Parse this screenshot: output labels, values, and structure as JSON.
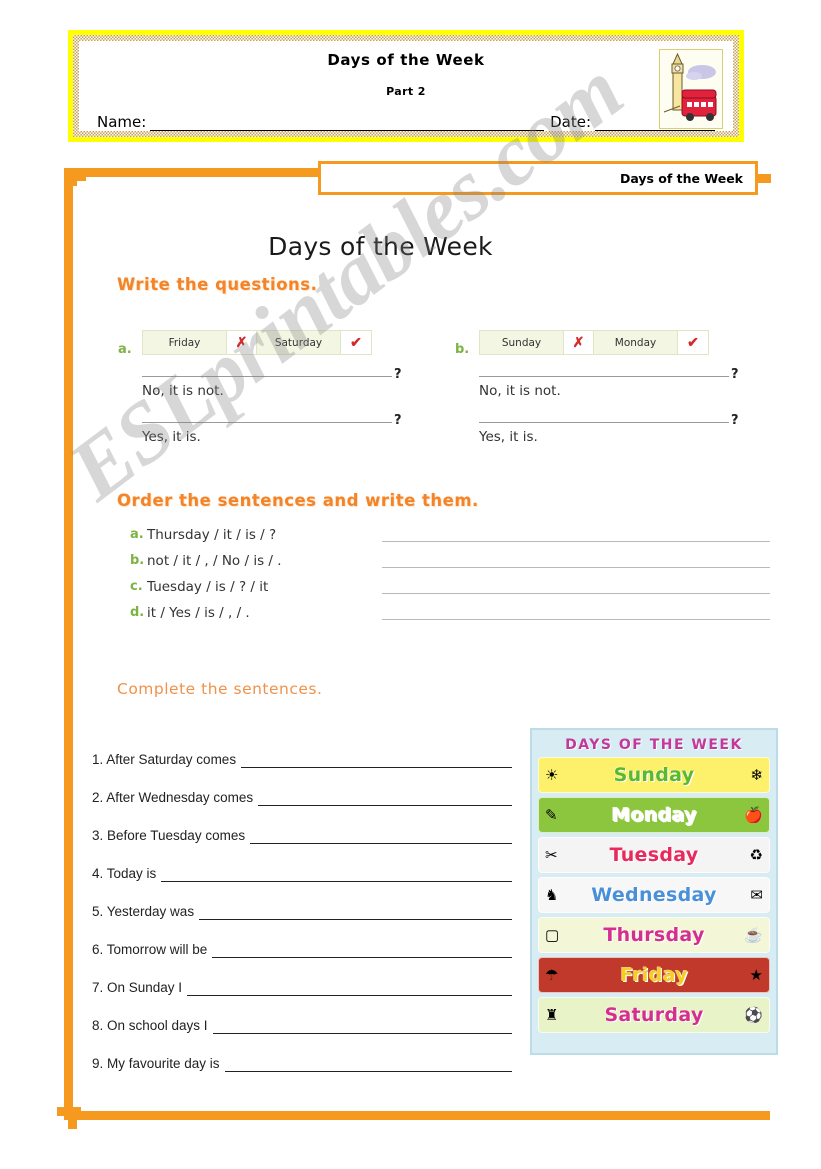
{
  "header": {
    "title": "Days of the Week",
    "part": "Part 2",
    "name_label": "Name:",
    "date_label": "Date:",
    "illustration": "big-ben-and-london-bus"
  },
  "tab": {
    "label": "Days of the Week"
  },
  "main_title": "Days of the Week",
  "watermark": "ESLprintables.com",
  "sections": {
    "write_questions": {
      "heading": "Write the questions.",
      "items": [
        {
          "label": "a.",
          "table": {
            "day1": "Friday",
            "mark1": "✗",
            "day2": "Saturday",
            "mark2": "✔"
          },
          "question_mark": "?",
          "answer1": "No, it is not.",
          "answer2": "Yes, it is."
        },
        {
          "label": "b.",
          "table": {
            "day1": "Sunday",
            "mark1": "✗",
            "day2": "Monday",
            "mark2": "✔"
          },
          "question_mark": "?",
          "answer1": "No, it is not.",
          "answer2": "Yes, it is."
        }
      ]
    },
    "order_sentences": {
      "heading": "Order the sentences and write them.",
      "items": [
        {
          "label": "a.",
          "text": "Thursday / it / is / ?"
        },
        {
          "label": "b.",
          "text": "not / it / , / No / is / ."
        },
        {
          "label": "c.",
          "text": "Tuesday / is / ? / it"
        },
        {
          "label": "d.",
          "text": "it / Yes / is / , / ."
        }
      ]
    },
    "complete_sentences": {
      "heading": "Complete the sentences.",
      "items": [
        "1. After Saturday comes",
        "2. After Wednesday comes",
        "3. Before Tuesday comes",
        "4. Today is",
        "5. Yesterday was",
        "6. Tomorrow will be",
        "7. On Sunday I",
        "8. On school days I",
        "9. My favourite day is"
      ]
    }
  },
  "poster": {
    "title": "DAYS OF THE WEEK",
    "days": [
      {
        "name": "Sunday",
        "text_color": "#5cb82e",
        "bg": "#fdf06a",
        "deco_left": "☀",
        "deco_right": "❄"
      },
      {
        "name": "Monday",
        "text_color": "#ffffff",
        "bg": "#8cc63f",
        "deco_left": "✎",
        "deco_right": "🍎"
      },
      {
        "name": "Tuesday",
        "text_color": "#e8295c",
        "bg": "#f4f4f4",
        "deco_left": "✂",
        "deco_right": "♻"
      },
      {
        "name": "Wednesday",
        "text_color": "#4a90d9",
        "bg": "#f7f7f7",
        "deco_left": "♞",
        "deco_right": "✉"
      },
      {
        "name": "Thursday",
        "text_color": "#d42f8e",
        "bg": "#f3f7d8",
        "deco_left": "▢",
        "deco_right": "☕"
      },
      {
        "name": "Friday",
        "text_color": "#f5d020",
        "bg": "#c0392b",
        "deco_left": "☂",
        "deco_right": "★"
      },
      {
        "name": "Saturday",
        "text_color": "#d42f8e",
        "bg": "#e8f4c8",
        "deco_left": "♜",
        "deco_right": "⚽"
      }
    ]
  },
  "colors": {
    "frame_orange": "#f59a1e",
    "header_yellow": "#ffff00",
    "heading_orange": "#f4842a",
    "item_green": "#7cb342",
    "mark_red": "#d32b2b",
    "table_cell": "#f2f6e3"
  }
}
